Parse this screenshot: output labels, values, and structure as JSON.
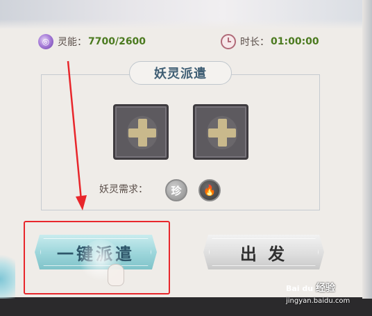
{
  "stats": {
    "energy_label": "灵能：",
    "energy_value": "7700/2600",
    "time_label": "时长：",
    "time_value": "01:00:00"
  },
  "panel": {
    "title": "妖灵派遣",
    "slots": [
      {
        "icon": "plus-icon"
      },
      {
        "icon": "plus-icon"
      }
    ],
    "requirement_label": "妖灵需求：",
    "requirement_icons": [
      "rare-badge-icon",
      "fire-element-icon"
    ],
    "rare_badge_glyph": "珍",
    "fire_glyph": "🔥"
  },
  "buttons": {
    "auto_dispatch": "一键派遣",
    "depart": "出 发"
  },
  "watermark": {
    "logo": "Bai du",
    "brand": "经验",
    "url": "jingyan.baidu.com"
  },
  "colors": {
    "annotation_red": "#e8262b",
    "value_green": "#4b7a1f",
    "title_blue": "#3f5e74"
  }
}
